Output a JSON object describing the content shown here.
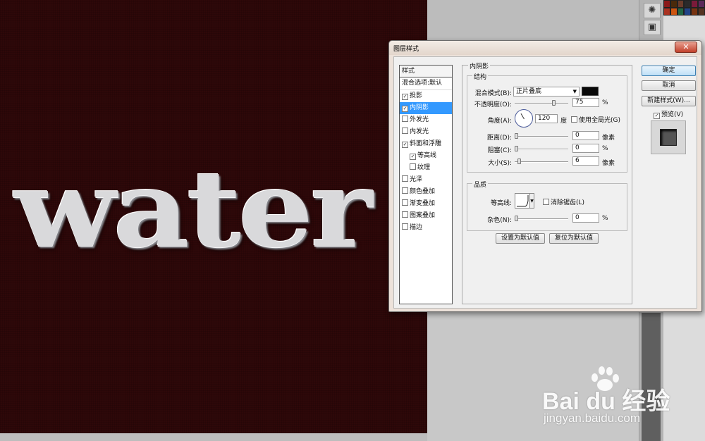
{
  "canvas": {
    "text": "water"
  },
  "dialog": {
    "title": "图层样式",
    "close_glyph": "✕",
    "styles_header": "样式",
    "style_items": [
      {
        "label": "混合选项:默认",
        "checkbox": false,
        "checked": false,
        "active": false,
        "indent": false
      },
      {
        "label": "投影",
        "checkbox": true,
        "checked": true,
        "active": false,
        "indent": false
      },
      {
        "label": "内阴影",
        "checkbox": true,
        "checked": true,
        "active": true,
        "indent": false
      },
      {
        "label": "外发光",
        "checkbox": true,
        "checked": false,
        "active": false,
        "indent": false
      },
      {
        "label": "内发光",
        "checkbox": true,
        "checked": false,
        "active": false,
        "indent": false
      },
      {
        "label": "斜面和浮雕",
        "checkbox": true,
        "checked": true,
        "active": false,
        "indent": false
      },
      {
        "label": "等高线",
        "checkbox": true,
        "checked": true,
        "active": false,
        "indent": true
      },
      {
        "label": "纹理",
        "checkbox": true,
        "checked": false,
        "active": false,
        "indent": true
      },
      {
        "label": "光泽",
        "checkbox": true,
        "checked": false,
        "active": false,
        "indent": false
      },
      {
        "label": "颜色叠加",
        "checkbox": true,
        "checked": false,
        "active": false,
        "indent": false
      },
      {
        "label": "渐变叠加",
        "checkbox": true,
        "checked": false,
        "active": false,
        "indent": false
      },
      {
        "label": "图案叠加",
        "checkbox": true,
        "checked": false,
        "active": false,
        "indent": false
      },
      {
        "label": "描边",
        "checkbox": true,
        "checked": false,
        "active": false,
        "indent": false
      }
    ],
    "section_title": "内阴影",
    "structure": {
      "title": "结构",
      "blend_mode_label": "混合模式(B):",
      "blend_mode_value": "正片叠底",
      "blend_color": "#080808",
      "opacity_label": "不透明度(O):",
      "opacity_value": "75",
      "opacity_unit": "%",
      "opacity_fraction": 0.75,
      "angle_label": "角度(A):",
      "angle_value": "120",
      "angle_unit": "度",
      "global_light_label": "使用全局光(G)",
      "global_light_checked": false,
      "distance_label": "距离(D):",
      "distance_value": "0",
      "distance_unit": "像素",
      "choke_label": "阻塞(C):",
      "choke_value": "0",
      "choke_unit": "%",
      "size_label": "大小(S):",
      "size_value": "6",
      "size_unit": "像素"
    },
    "quality": {
      "title": "品质",
      "contour_label": "等高线:",
      "antialias_label": "消除锯齿(L)",
      "antialias_checked": false,
      "noise_label": "杂色(N):",
      "noise_value": "0",
      "noise_unit": "%"
    },
    "make_default_label": "设置为默认值",
    "reset_default_label": "复位为默认值",
    "ok_label": "确定",
    "cancel_label": "取消",
    "new_style_label": "新建样式(W)...",
    "preview_label": "预览(V)",
    "preview_checked": true
  },
  "watermark": {
    "brand": "Bai du 经验",
    "url": "jingyan.baidu.com"
  },
  "side_icons": [
    "sparkle-icon",
    "image-icon"
  ],
  "swatch_colors": [
    "#8b1a1a",
    "#4a2a0a",
    "#6a3b2a",
    "#2a2a2a",
    "#7a1a3a",
    "#5a2a5a",
    "#aa3322",
    "#cc5511",
    "#226644",
    "#224488",
    "#773311",
    "#553322"
  ]
}
